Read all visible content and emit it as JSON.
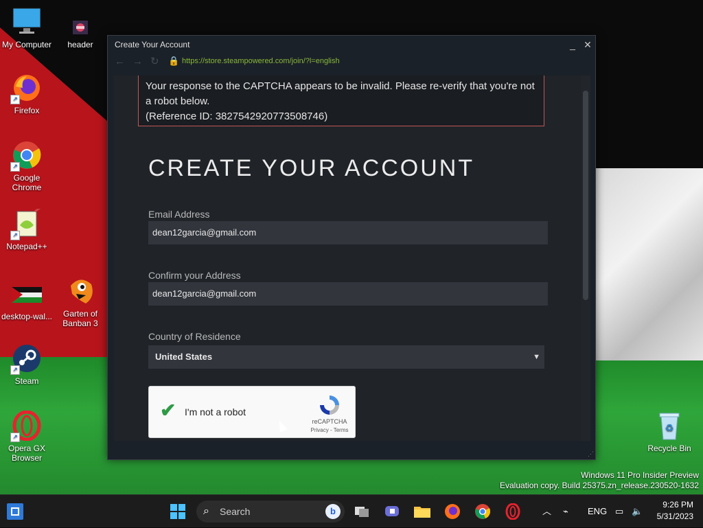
{
  "desktop": {
    "icons": [
      {
        "label": "My Computer",
        "icon": "monitor-icon"
      },
      {
        "label": "header",
        "icon": "image-file-icon"
      },
      {
        "label": "Firefox",
        "icon": "firefox-icon"
      },
      {
        "label": "Google Chrome",
        "icon": "chrome-icon"
      },
      {
        "label": "Notepad++",
        "icon": "notepad-plus-plus-icon"
      },
      {
        "label": "desktop-wal...",
        "icon": "flag-image-icon"
      },
      {
        "label": "Garten of Banban 3",
        "icon": "bird-character-icon"
      },
      {
        "label": "Steam",
        "icon": "steam-icon"
      },
      {
        "label": "Opera GX Browser",
        "icon": "opera-gx-icon"
      },
      {
        "label": "Recycle Bin",
        "icon": "recycle-bin-icon"
      }
    ]
  },
  "window": {
    "title": "Create Your Account",
    "url": "https://store.steampowered.com/join/?l=english",
    "error_message": "Your response to the CAPTCHA appears to be invalid. Please re-verify that you're not a robot below.",
    "reference": "(Reference ID: 3827542920773508746)",
    "page_title": "CREATE YOUR ACCOUNT",
    "email_label": "Email Address",
    "email_value": "dean12garcia@gmail.com",
    "confirm_label": "Confirm your Address",
    "confirm_value": "dean12garcia@gmail.com",
    "country_label": "Country of Residence",
    "country_value": "United States",
    "captcha_text": "I'm not a robot",
    "captcha_brand": "reCAPTCHA",
    "captcha_links": "Privacy - Terms"
  },
  "watermark": {
    "line1": "Windows 11 Pro Insider Preview",
    "line2": "Evaluation copy. Build 25375.zn_release.230520-1632"
  },
  "taskbar": {
    "search_placeholder": "Search",
    "lang": "ENG",
    "time": "9:26 PM",
    "date": "5/31/2023"
  },
  "colors": {
    "steam_bg": "#1b2128",
    "error_border": "#c15755",
    "url_green": "#88b83a",
    "captcha_check": "#2e9b46"
  }
}
